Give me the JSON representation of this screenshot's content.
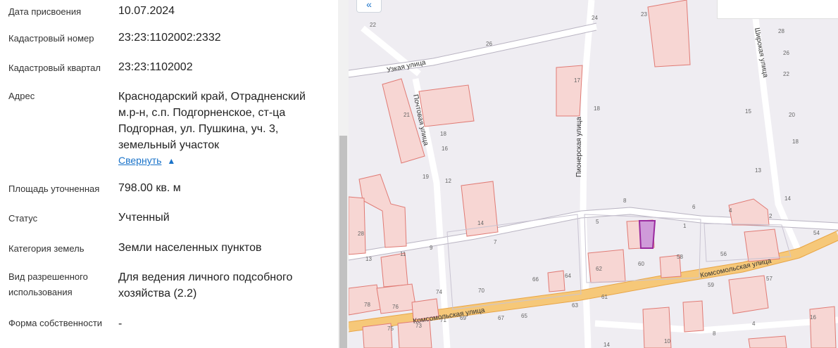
{
  "fields": [
    {
      "label": "Дата присвоения",
      "value": "10.07.2024"
    },
    {
      "label": "Кадастровый номер",
      "value": "23:23:1102002:2332"
    },
    {
      "label": "Кадастровый квартал",
      "value": "23:23:1102002"
    },
    {
      "label": "Адрес",
      "value": "Краснодарский край, Отрадненский м.р-н, с.п. Подгорненское, ст-ца Подгорная, ул. Пушкина, уч. 3, земельный участок"
    },
    {
      "label": "Площадь уточненная",
      "value": "798.00 кв. м"
    },
    {
      "label": "Статус",
      "value": "Учтенный"
    },
    {
      "label": "Категория земель",
      "value": "Земли населенных пунктов"
    },
    {
      "label": "Вид разрешенного использования",
      "value": "Для ведения личного подсобного хозяйства (2.2)"
    },
    {
      "label": "Форма собственности",
      "value": "-"
    }
  ],
  "collapse_link": "Свернуть",
  "map": {
    "expand_button": "«",
    "streets": [
      "Узкая улица",
      "Почтовая улица",
      "Пионерская улица",
      "Широкая улица",
      "Комсомольская улица",
      "Комсомольская улица"
    ],
    "selected_parcel_color": "#cf9bd9",
    "parcel_color": "#f7d6d3",
    "parcel_border_color": "#e07a74",
    "numbers": [
      "22",
      "26",
      "24",
      "23",
      "28",
      "26",
      "22",
      "15",
      "20",
      "18",
      "13",
      "14",
      "54",
      "4",
      "2",
      "6",
      "8",
      "5",
      "1",
      "56",
      "58",
      "60",
      "62",
      "64",
      "66",
      "61",
      "63",
      "65",
      "67",
      "69",
      "70",
      "71",
      "73",
      "74",
      "76",
      "78",
      "75",
      "13",
      "11",
      "9",
      "7",
      "19",
      "12",
      "14",
      "21",
      "18",
      "16",
      "17",
      "18",
      "28",
      "59",
      "57",
      "16",
      "8",
      "10",
      "14",
      "4"
    ]
  }
}
